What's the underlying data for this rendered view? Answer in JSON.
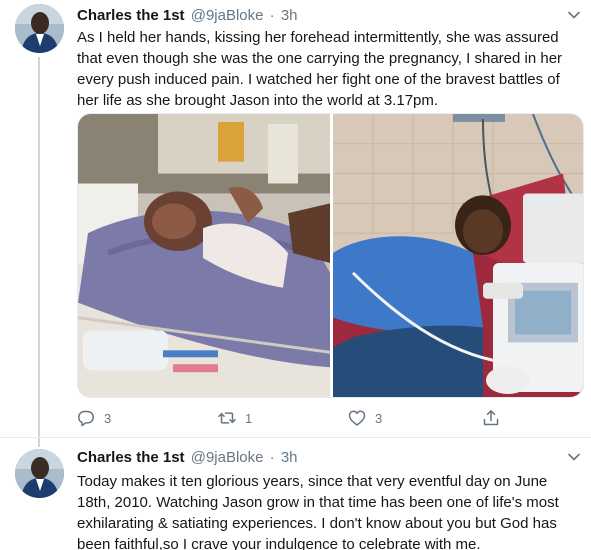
{
  "tweets": [
    {
      "name": "Charles the 1st",
      "handle": "@9jaBloke",
      "separator": "·",
      "time": "3h",
      "text": "As I held her hands, kissing her forehead intermittently, she was assured that even though she was the one carrying the pregnancy, I shared in her every push induced pain. I watched her fight one of the bravest battles of her life as she brought Jason into the world at 3.17pm.",
      "actions": {
        "replies": "3",
        "retweets": "1",
        "likes": "3"
      }
    },
    {
      "name": "Charles the 1st",
      "handle": "@9jaBloke",
      "separator": "·",
      "time": "3h",
      "text": "Today makes it ten glorious years, since that very eventful day on June 18th, 2010. Watching Jason grow in that time has been one of life's most exhilarating & satiating experiences. I don't know about you but God has been faithful,so I crave your indulgence to celebrate with me."
    }
  ],
  "icons": {
    "reply": "reply-icon",
    "retweet": "retweet-icon",
    "like": "heart-icon",
    "share": "share-icon",
    "menu": "chevron-down-icon"
  },
  "colors": {
    "text": "#14171a",
    "secondary": "#657786",
    "divider": "#e6ecf0",
    "thread_line": "#ccd6dd"
  }
}
